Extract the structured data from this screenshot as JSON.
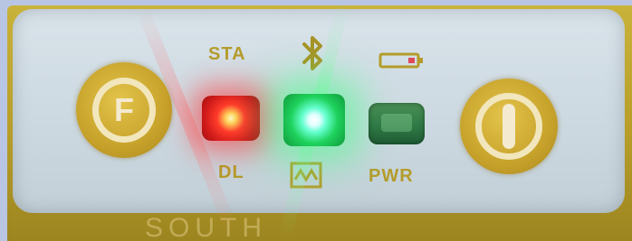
{
  "labels": {
    "sta": "STA",
    "dl": "DL",
    "pwr": "PWR"
  },
  "buttons": {
    "function_glyph": "F"
  },
  "brand": "SOUTH",
  "leds": {
    "sta_color": "#e02020",
    "bluetooth_color": "#2ad36a",
    "pwr_color": "#2f7a46"
  },
  "icons": [
    "bluetooth-icon",
    "battery-icon",
    "data-link-icon",
    "power-icon"
  ]
}
